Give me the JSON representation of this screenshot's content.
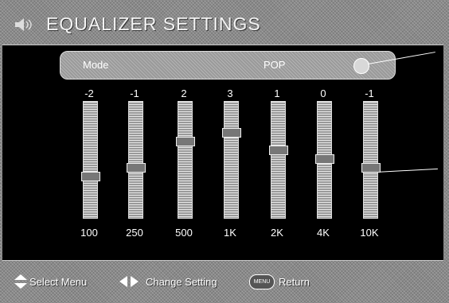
{
  "header": {
    "title": "EQUALIZER SETTINGS",
    "icon": "speaker-icon"
  },
  "mode": {
    "label": "Mode",
    "value": "POP"
  },
  "bands": [
    {
      "value": "-2",
      "freq": "100",
      "level": -2
    },
    {
      "value": "-1",
      "freq": "250",
      "level": -1
    },
    {
      "value": "2",
      "freq": "500",
      "level": 2
    },
    {
      "value": "3",
      "freq": "1K",
      "level": 3
    },
    {
      "value": "1",
      "freq": "2K",
      "level": 1
    },
    {
      "value": "0",
      "freq": "4K",
      "level": 0
    },
    {
      "value": "-1",
      "freq": "10K",
      "level": -1
    }
  ],
  "footer": {
    "select_label": "Select Menu",
    "change_label": "Change Setting",
    "menu_key": "MENU",
    "return_label": "Return",
    "icons": [
      "up-down-arrow-icon",
      "left-right-arrow-icon",
      "menu-button-icon"
    ]
  }
}
